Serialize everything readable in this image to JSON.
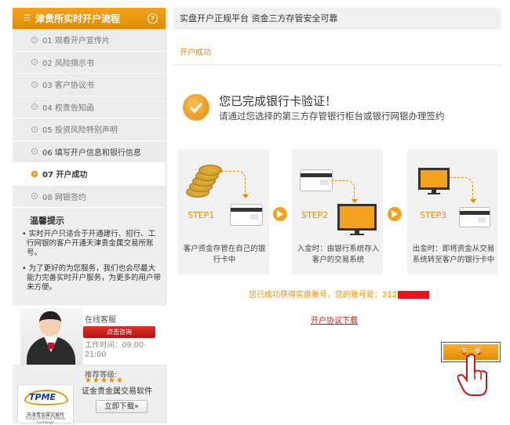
{
  "sidebar": {
    "title": "津贵所实时开户流程",
    "steps": [
      {
        "label": "01 观看开户宣传片"
      },
      {
        "label": "02 风险揭示书"
      },
      {
        "label": "03 客户协议书"
      },
      {
        "label": "04 权责告知函"
      },
      {
        "label": "05 投资风险特别声明"
      },
      {
        "label": "06 填写开户信息和银行信息"
      },
      {
        "label": "07 开户成功"
      },
      {
        "label": "08 网银签约"
      }
    ],
    "tips": {
      "title": "温馨提示",
      "items": [
        "实时开户只适合于开通建行、招行、工行网银的客户开通天津贵金属交易所账号。",
        "为了更好的为您服务，我们也会尽最大能力完善实时开户服务，为更多的用户带来方便。"
      ]
    },
    "service": {
      "label": "在线客服",
      "button": "点击咨询",
      "hours": "工作时间：09:00-21:00"
    },
    "recommend": {
      "label": "推荐等级:",
      "stars": "★★★★★",
      "rating": 5,
      "name": "证金贵金属交易软件",
      "download": "立即下载»",
      "logo_text": "TPME",
      "logo_cn": "天津贵金属交易所",
      "logo_en": "Tianjin Precious Metals Exchange"
    }
  },
  "main": {
    "banner": "实盘开户正规平台 资金三方存管安全可靠",
    "section_title": "开户成功",
    "success_title": "您已完成银行卡验证！",
    "success_sub": "请通过您选择的第三方存管银行柜台或银行网银办理签约",
    "flow": [
      {
        "step": "STEP1",
        "caption": "客户资金存管在自己的银行卡中"
      },
      {
        "step": "STEP2",
        "caption": "入金时：由银行系统存入客户的交易系统"
      },
      {
        "step": "STEP3",
        "caption": "出金时：即将资金从交易系统转至客户的银行卡中"
      }
    ],
    "account_text": "您已成功获得实盘账号，您的账号是：212",
    "agreement_link": "开户协议下载",
    "next_button": "下一步"
  },
  "colors": {
    "accent": "#f3a21d",
    "accent_text": "#f08c00",
    "link_red": "#d41313"
  }
}
